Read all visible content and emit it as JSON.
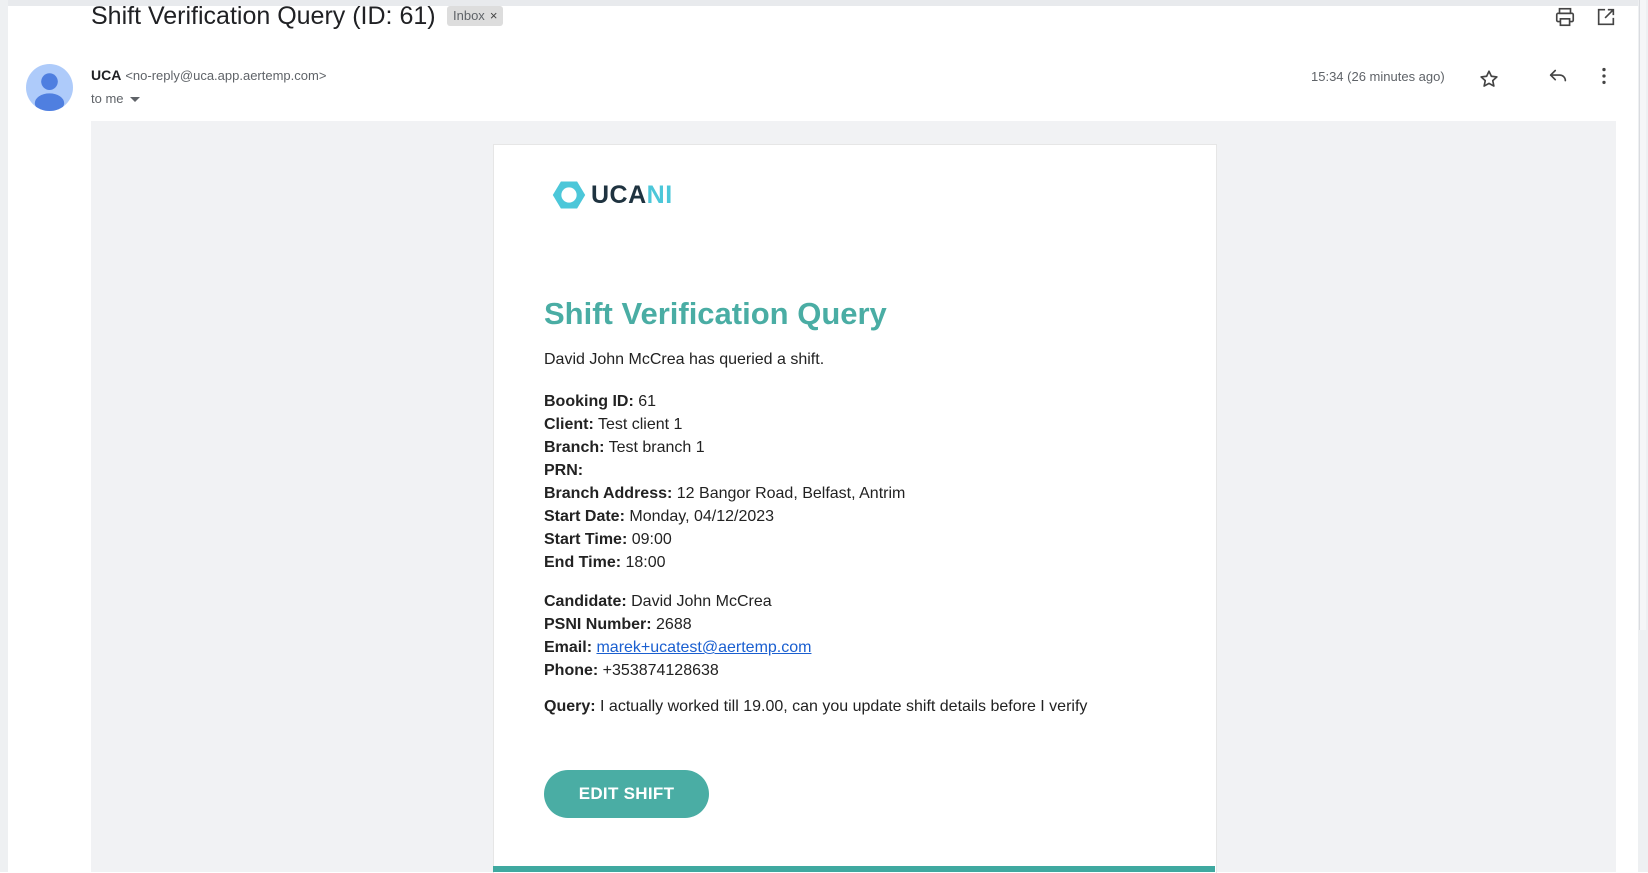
{
  "email": {
    "subject": "Shift Verification Query (ID: 61)",
    "label_chip": "Inbox",
    "label_chip_close": "×",
    "sender_name": "UCA",
    "sender_address": "<no-reply@uca.app.aertemp.com>",
    "recipient": "to me",
    "timestamp": "15:34 (26 minutes ago)",
    "icons": [
      "print-icon",
      "open-in-new-window-icon",
      "star-icon",
      "reply-icon",
      "more-options-icon",
      "expand-recipients-icon"
    ]
  },
  "body": {
    "logo": {
      "part1": "UCA",
      "part2": "NI"
    },
    "heading": "Shift Verification Query",
    "intro": "David John McCrea has queried a shift.",
    "shift_details": [
      {
        "label": "Booking ID:",
        "value": "61"
      },
      {
        "label": "Client:",
        "value": "Test client 1"
      },
      {
        "label": "Branch:",
        "value": "Test branch 1"
      },
      {
        "label": "PRN:",
        "value": ""
      },
      {
        "label": "Branch Address:",
        "value": "12 Bangor Road, Belfast, Antrim"
      },
      {
        "label": "Start Date:",
        "value": "Monday, 04/12/2023"
      },
      {
        "label": "Start Time:",
        "value": "09:00"
      },
      {
        "label": "End Time:",
        "value": "18:00"
      }
    ],
    "candidate": {
      "candidate_label": "Candidate:",
      "candidate_value": "David John McCrea",
      "psni_label": "PSNI Number:",
      "psni_value": "2688",
      "email_label": "Email:",
      "email_value": "marek+ucatest@aertemp.com",
      "phone_label": "Phone:",
      "phone_value": "+353874128638"
    },
    "query": {
      "label": "Query:",
      "value": "I actually worked till 19.00, can you update shift details before I verify"
    },
    "button_label": "EDIT SHIFT"
  },
  "colors": {
    "accent": "#4aada4",
    "logo_dark": "#1f3340",
    "logo_light": "#4cc7d9",
    "link": "#1a5fd0"
  }
}
